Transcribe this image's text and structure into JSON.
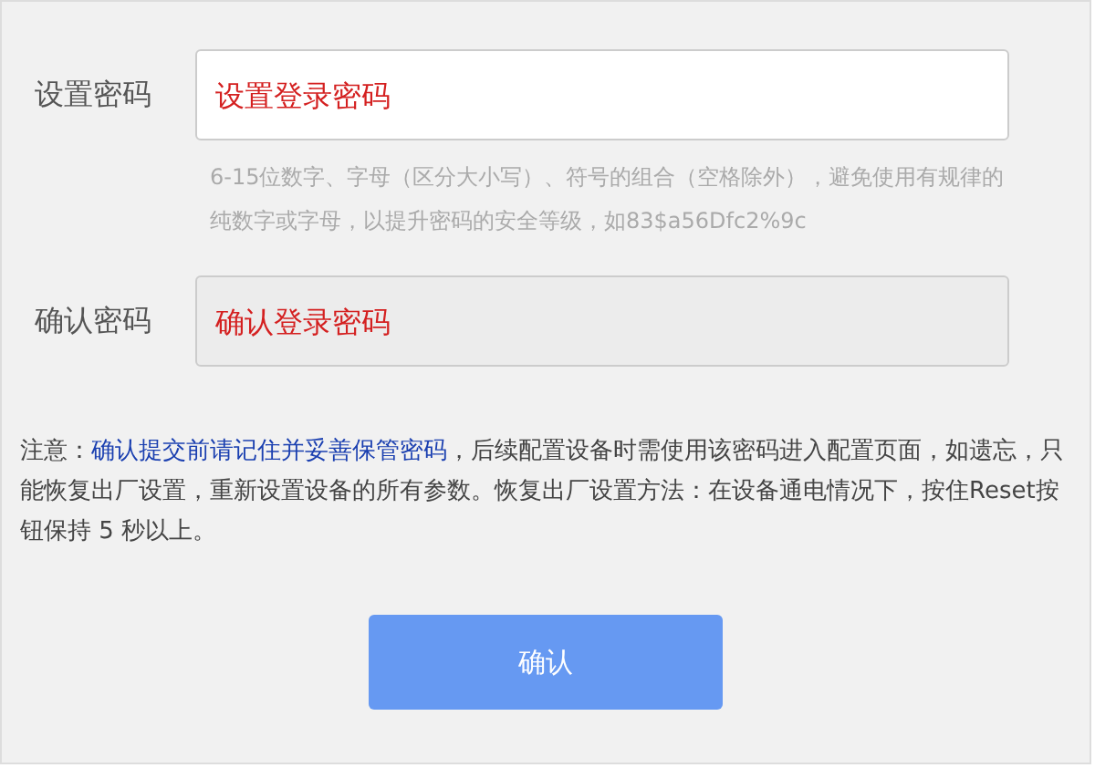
{
  "fields": [
    {
      "label": "设置密码",
      "placeholder": "设置登录密码",
      "disabled": false,
      "hint": "6-15位数字、字母（区分大小写）、符号的组合（空格除外），避免使用有规律的纯数字或字母，以提升密码的安全等级，如83$a56Dfc2%9c"
    },
    {
      "label": "确认密码",
      "placeholder": "确认登录密码",
      "disabled": true
    }
  ],
  "note": "注意：**确认提交前请记住并妥善保管密码**，后续配置设备时需使用该密码进入配置页面，如遗忘，只能恢复出厂设置，重新设置设备的所有参数。恢复出厂设置方法：在设备通电情况下，按住Reset按钮保持 5 秒以上。",
  "buttons": [
    "确认"
  ]
}
